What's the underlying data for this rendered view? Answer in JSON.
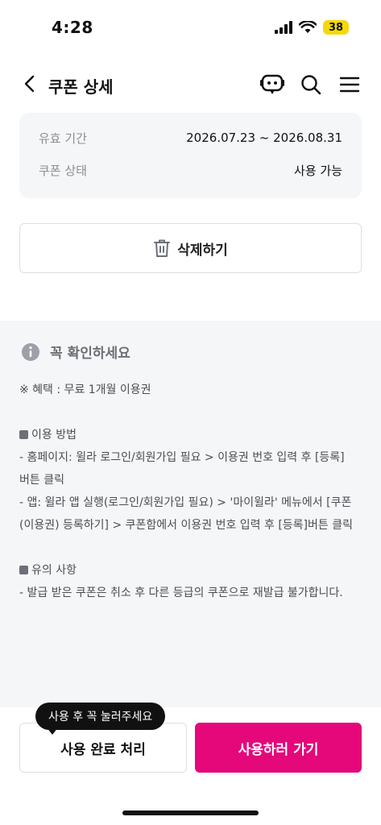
{
  "status_bar": {
    "time": "4:28",
    "battery": "38",
    "icons": [
      "cellular-signal-icon",
      "wifi-icon",
      "battery-icon"
    ],
    "battery_color": "#f5d90a"
  },
  "header": {
    "title": "쿠폰 상세",
    "icons": [
      "back-icon",
      "chatbot-icon",
      "search-icon",
      "menu-icon"
    ]
  },
  "coupon_info": {
    "rows": [
      {
        "label": "유효 기간",
        "value": "2026.07.23 ~ 2026.08.31"
      },
      {
        "label": "쿠폰 상태",
        "value": "사용 가능"
      }
    ]
  },
  "delete_button": {
    "label": "삭제하기",
    "icon": "trash-icon"
  },
  "notice": {
    "title": "꼭 확인하세요",
    "icon": "info-icon",
    "benefit": "※ 혜택 : 무료 1개월 이용권",
    "usage_title": "이용 방법",
    "usage_lines": [
      "- 홈페이지: 윌라 로그인/회원가입 필요 > 이용권 번호 입력 후 [등록] 버튼 클릭",
      "- 앱: 윌라 앱 실행(로그인/회원가입 필요) > '마이윌라' 메뉴에서 [쿠폰(이용권) 등록하기] > 쿠폰함에서 이용권 번호 입력 후 [등록]버튼 클릭"
    ],
    "caution_title": "유의 사항",
    "caution_lines": [
      "- 발급 받은 쿠폰은 취소 후 다른 등급의 쿠폰으로 재발급 불가합니다."
    ]
  },
  "bottom_bar": {
    "tooltip": "사용 후 꼭 눌러주세요",
    "complete_label": "사용 완료 처리",
    "use_label": "사용하러 가기",
    "accent_color": "#e4087a"
  }
}
